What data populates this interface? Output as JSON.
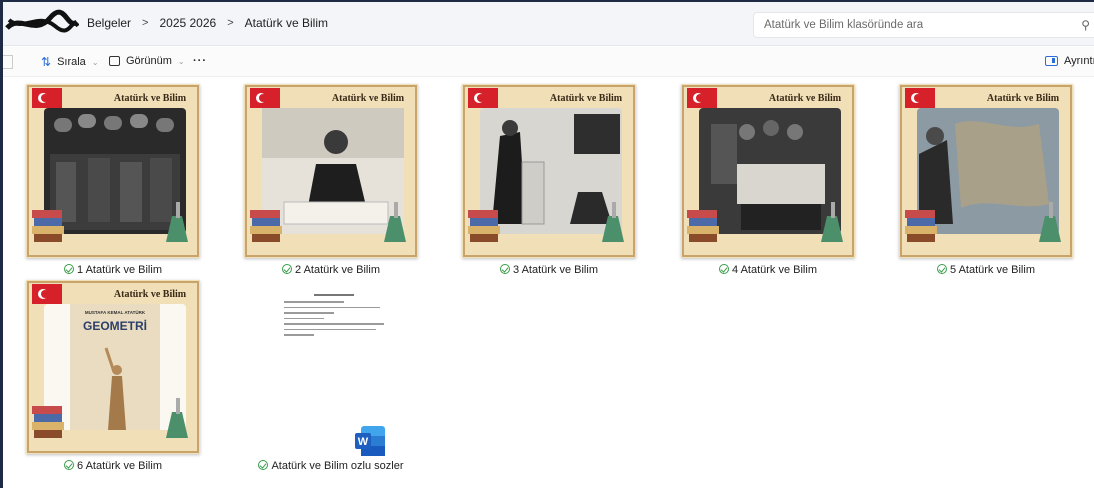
{
  "breadcrumb": {
    "items": [
      "Belgeler",
      "2025 2026",
      "Atatürk ve Bilim"
    ],
    "separator": ">"
  },
  "search": {
    "placeholder": "Atatürk ve Bilim klasöründe ara",
    "icon": "search-icon"
  },
  "toolbar": {
    "sort_label": "Sırala",
    "view_label": "Görünüm",
    "more_label": "···",
    "details_label": "Ayrıntılar"
  },
  "thumb_text": {
    "card_title": "Atatürk ve Bilim",
    "book_author": "MUSTAFA KEMAL ATATÜRK",
    "book_title": "GEOMETRİ"
  },
  "files": [
    {
      "name": "1 Atatürk ve Bilim",
      "type": "image",
      "status": "synced"
    },
    {
      "name": "2 Atatürk ve Bilim",
      "type": "image",
      "status": "synced"
    },
    {
      "name": "3 Atatürk ve Bilim",
      "type": "image",
      "status": "synced"
    },
    {
      "name": "4 Atatürk ve Bilim",
      "type": "image",
      "status": "synced"
    },
    {
      "name": "5 Atatürk ve Bilim",
      "type": "image",
      "status": "synced"
    },
    {
      "name": "6 Atatürk ve Bilim",
      "type": "image",
      "status": "synced"
    },
    {
      "name": "Atatürk ve Bilim ozlu sozler",
      "type": "word-document",
      "status": "synced"
    }
  ],
  "colors": {
    "frame": "#f1dfb8",
    "frame_border": "#c9a46a",
    "flag": "#d6202a",
    "word_blue": "#1f5fbf",
    "sync_green": "#3a9d4a"
  }
}
